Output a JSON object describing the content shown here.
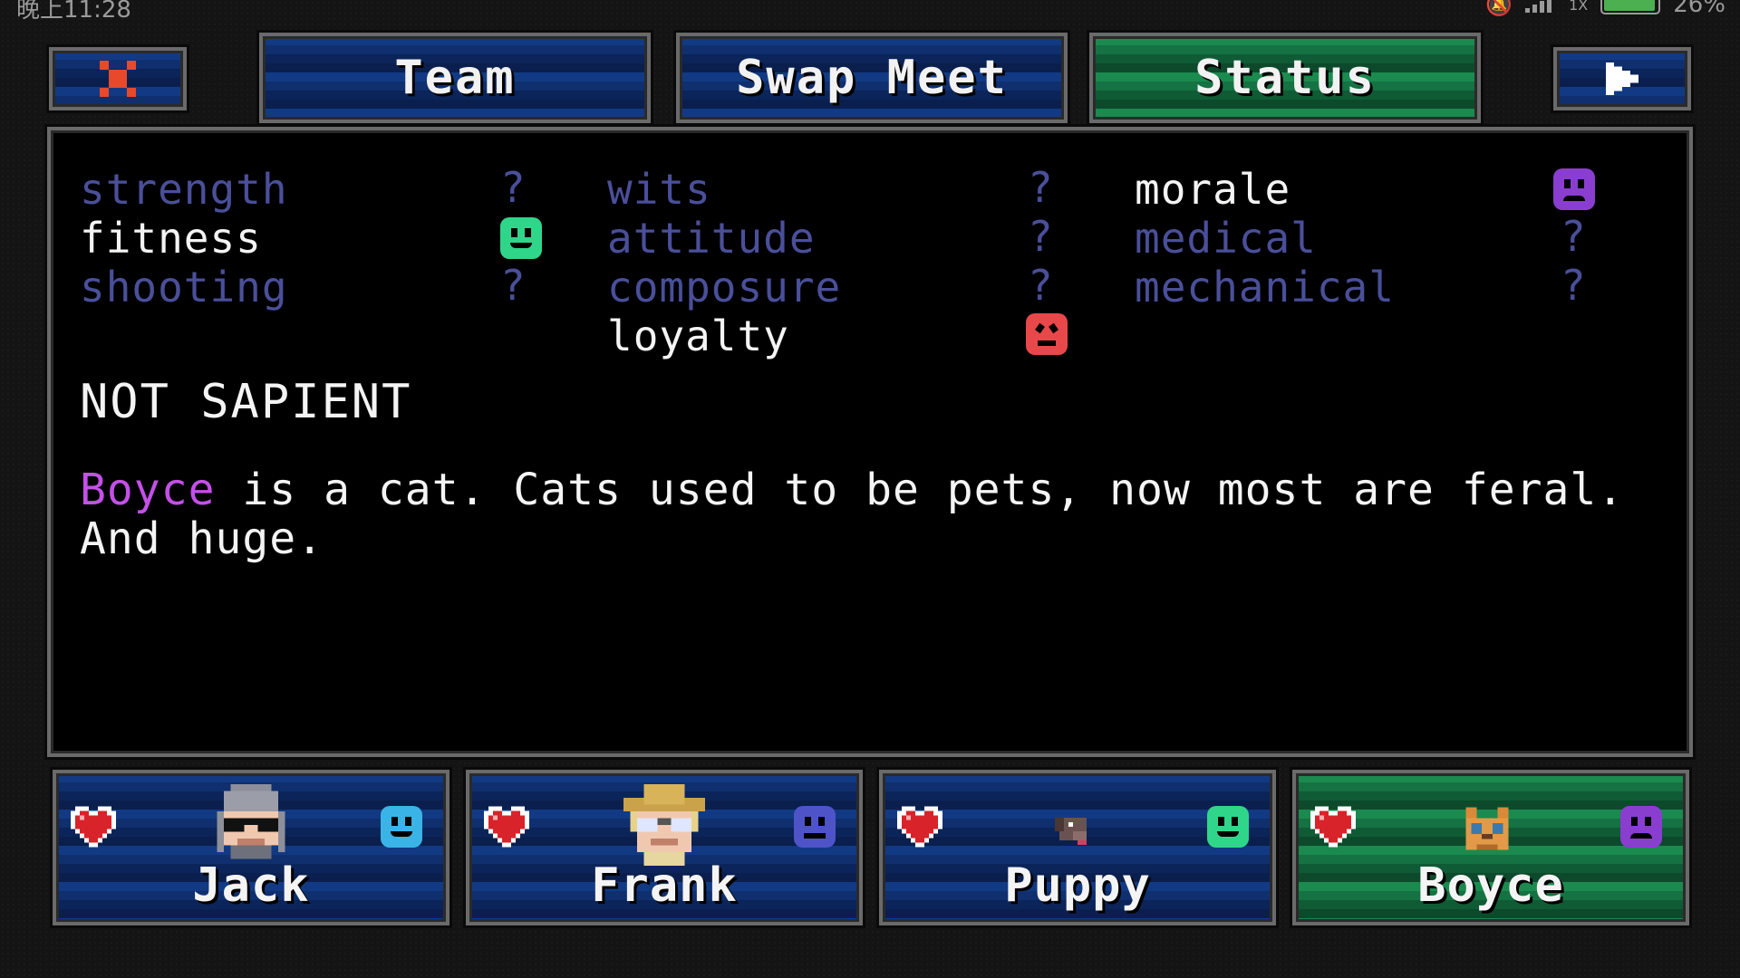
{
  "status_bar": {
    "time": "晚上11:28",
    "signal_text": "1X",
    "battery": "26%",
    "battery_level": 0.26
  },
  "tabs": {
    "team": "Team",
    "swap_meet": "Swap Meet",
    "status": "Status"
  },
  "stats": {
    "col1": [
      {
        "label": "strength",
        "value": "?"
      },
      {
        "label": "fitness",
        "value": "green-happy-face"
      },
      {
        "label": "shooting",
        "value": "?"
      }
    ],
    "col2": [
      {
        "label": "wits",
        "value": "?"
      },
      {
        "label": "attitude",
        "value": "?"
      },
      {
        "label": "composure",
        "value": "?"
      },
      {
        "label": "loyalty",
        "value": "red-angry-face"
      }
    ],
    "col3": [
      {
        "label": "morale",
        "value": "purple-sad-face"
      },
      {
        "label": "medical",
        "value": "?"
      },
      {
        "label": "mechanical",
        "value": "?"
      }
    ]
  },
  "heading": "NOT SAPIENT",
  "description": {
    "name": "Boyce",
    "text": " is a cat. Cats used to be pets, now most are feral. And huge."
  },
  "team": [
    {
      "name": "Jack",
      "mood_color": "#3ab4e6"
    },
    {
      "name": "Frank",
      "mood_color": "#4e54c8"
    },
    {
      "name": "Puppy",
      "mood_color": "#2fd68a"
    },
    {
      "name": "Boyce",
      "mood_color": "#8a3ed0"
    }
  ],
  "colors": {
    "dim_text": "#4a4f9a",
    "name_accent": "#c450e8",
    "heart": "#d8232a"
  }
}
